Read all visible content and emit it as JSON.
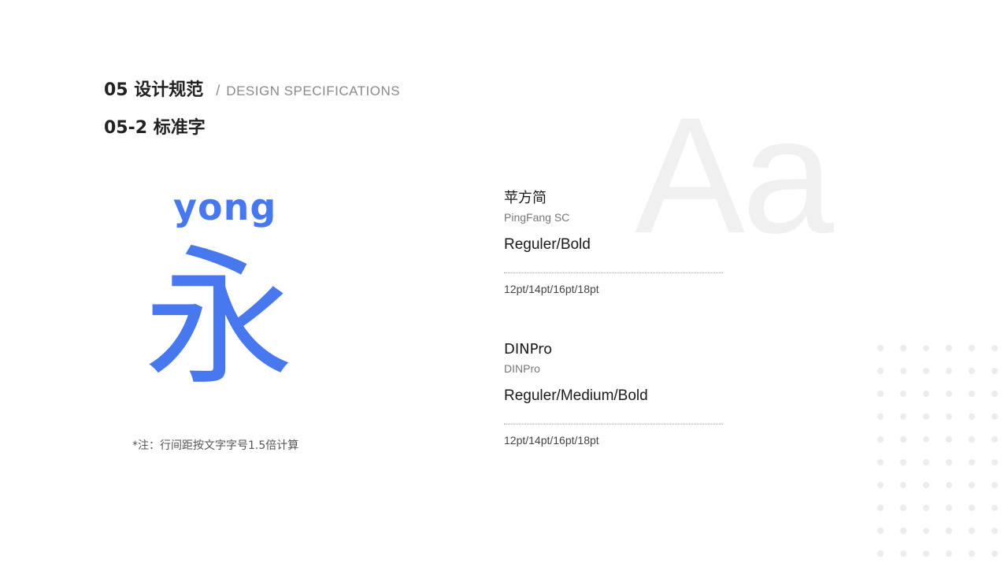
{
  "header": {
    "section_title": "05 设计规范",
    "slash": "/",
    "section_en": "DESIGN SPECIFICATIONS",
    "subsection": "05-2  标准字"
  },
  "watermark": "Aa",
  "sample": {
    "pinyin": "yong",
    "character": "永",
    "color": "#4878ee"
  },
  "note": "*注：行间距按文字字号1.5倍计算",
  "fonts": [
    {
      "name": "苹方简",
      "sub": "PingFang SC",
      "weights": "Reguler/Bold",
      "sizes": "12pt/14pt/16pt/18pt"
    },
    {
      "name": "DINPro",
      "sub": "DINPro",
      "weights": "Reguler/Medium/Bold",
      "sizes": "12pt/14pt/16pt/18pt"
    }
  ]
}
